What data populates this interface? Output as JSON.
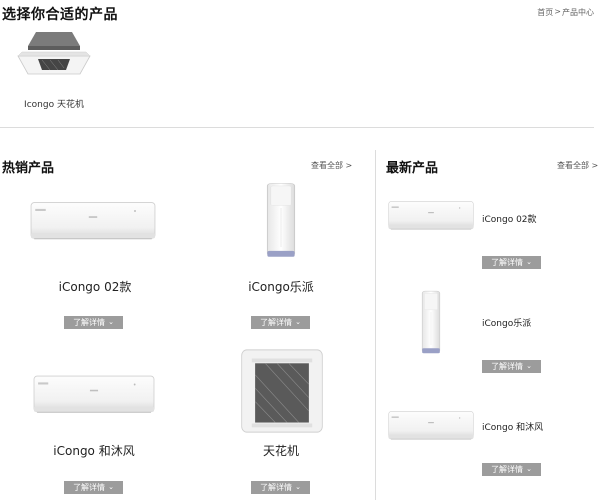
{
  "header": {
    "title": "选择你合适的产品",
    "breadcrumb": {
      "home": "首页",
      "sep": ">",
      "current": "产品中心"
    }
  },
  "category": {
    "label": "Icongo 天花机",
    "icon": "ceiling-ac-icon"
  },
  "hot": {
    "title": "热销产品",
    "view_all": "查看全部 >",
    "items": [
      {
        "name": "iCongo 02款",
        "button": "了解详情"
      },
      {
        "name": "iCongo乐派",
        "button": "了解详情"
      },
      {
        "name": "iCongo 和沐风",
        "button": "了解详情"
      },
      {
        "name": "天花机",
        "button": "了解详情"
      }
    ]
  },
  "latest": {
    "title": "最新产品",
    "view_all": "查看全部 >",
    "items": [
      {
        "name": "iCongo 02款",
        "button": "了解详情"
      },
      {
        "name": "iCongo乐派",
        "button": "了解详情"
      },
      {
        "name": "iCongo 和沐风",
        "button": "了解详情"
      }
    ]
  },
  "colors": {
    "button_bg": "#9c9c9c",
    "divider": "#dcdcdc"
  }
}
